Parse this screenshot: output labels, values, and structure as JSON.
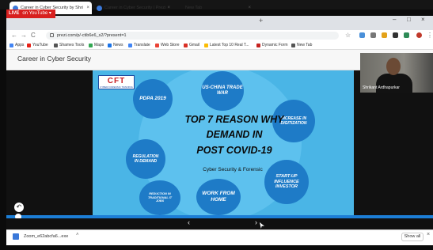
{
  "stream": {
    "live_label": "LIVE",
    "source_label": "on YouTube ▾"
  },
  "browser": {
    "tabs": [
      {
        "title": "Career in Cyber Security by Shri",
        "close": "×"
      },
      {
        "title": "Career in Cyber Security | Prezi",
        "close": "×"
      },
      {
        "title": "New Tab",
        "close": "×"
      }
    ],
    "new_tab": "+",
    "window_controls": {
      "minimize": "–",
      "maximize": "□",
      "close": "×"
    },
    "nav": {
      "back": "←",
      "forward": "→",
      "reload": "C",
      "home": "⌂"
    },
    "url": "prezi.com/p/-ctib6e6_s2/?present=1",
    "star": "☆",
    "menu": "⋮",
    "bookmarks": [
      {
        "label": "Apps",
        "color": "#4285f4"
      },
      {
        "label": "YouTube",
        "color": "#e62117"
      },
      {
        "label": "Shames Tools",
        "color": "#555555"
      },
      {
        "label": "Maps",
        "color": "#34a853"
      },
      {
        "label": "News",
        "color": "#1a73e8"
      },
      {
        "label": "Translate",
        "color": "#4285f4"
      },
      {
        "label": "Web Store",
        "color": "#ea4335"
      },
      {
        "label": "Gmail",
        "color": "#d93025"
      },
      {
        "label": "Latest Top 10 Real T...",
        "color": "#fbbc04"
      },
      {
        "label": "Dynamic Form",
        "color": "#c5221f"
      },
      {
        "label": "New Tab",
        "color": "#555555"
      }
    ]
  },
  "prezi": {
    "title": "Career in Cyber Security"
  },
  "webcam": {
    "name": "Shrikant Ardhapurkar"
  },
  "slide": {
    "logo_text": "CFT",
    "logo_sub": "CYBER FORENSIC TRAINING",
    "title_lines": [
      "TOP 7 REASON WHY",
      "DEMAND IN",
      "POST COVID-19"
    ],
    "subtitle": "Cyber Security & Forensic",
    "circles": {
      "us_china": "US-CHINA TRADE WAR",
      "pdpa": "PDPA 2019",
      "digitization": "INCREASE IN DIGITIZATION",
      "regulation": "REGULATION IN DEMAND",
      "startup": "START-UP INFLUENCE INVESTOR",
      "work_from_home": "WORK FROM HOME",
      "reduction": "REDUCTION IN TRADITIONAL IT JOBS"
    },
    "prev_icon": "↶"
  },
  "controls": {
    "prev": "‹",
    "next": "›",
    "progress_fraction": 0.02
  },
  "downloads": {
    "file_name": "Zoom_e62abcfa6...exe",
    "chevron": "˄",
    "show_all": "Show all",
    "close": "×"
  },
  "colors": {
    "slide_bg": "#4ab5e6",
    "circle": "#1e7bc7",
    "live": "#d8201f",
    "progress": "#1c7ed6"
  }
}
